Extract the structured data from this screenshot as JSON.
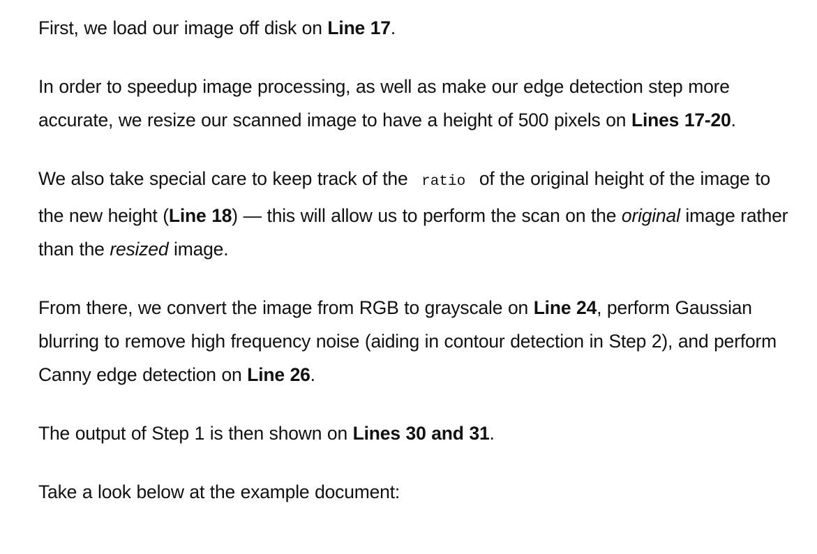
{
  "paragraphs": [
    {
      "segments": [
        {
          "text": "First, we load our image off disk on ",
          "style": "normal"
        },
        {
          "text": "Line 17",
          "style": "bold"
        },
        {
          "text": ".",
          "style": "normal"
        }
      ]
    },
    {
      "segments": [
        {
          "text": "In order to speedup image processing, as well as make our edge detection step more accurate, we resize our scanned image to have a height of 500 pixels on ",
          "style": "normal"
        },
        {
          "text": "Lines 17-20",
          "style": "bold"
        },
        {
          "text": ".",
          "style": "normal"
        }
      ]
    },
    {
      "segments": [
        {
          "text": "We also take special care to keep track of the ",
          "style": "normal"
        },
        {
          "text": "ratio",
          "style": "code"
        },
        {
          "text": " of the original height of the image to the new height (",
          "style": "normal"
        },
        {
          "text": "Line 18",
          "style": "bold"
        },
        {
          "text": ") — this will allow us to perform the scan on the ",
          "style": "normal"
        },
        {
          "text": "original",
          "style": "italic"
        },
        {
          "text": " image rather than the ",
          "style": "normal"
        },
        {
          "text": "resized",
          "style": "italic"
        },
        {
          "text": " image.",
          "style": "normal"
        }
      ]
    },
    {
      "segments": [
        {
          "text": "From there, we convert the image from RGB to grayscale on ",
          "style": "normal"
        },
        {
          "text": "Line 24",
          "style": "bold"
        },
        {
          "text": ", perform Gaussian blurring to remove high frequency noise (aiding in contour detection in Step 2), and perform Canny edge detection on ",
          "style": "normal"
        },
        {
          "text": "Line 26",
          "style": "bold"
        },
        {
          "text": ".",
          "style": "normal"
        }
      ]
    },
    {
      "segments": [
        {
          "text": "The output of Step 1 is then shown on ",
          "style": "normal"
        },
        {
          "text": "Lines 30 and 31",
          "style": "bold"
        },
        {
          "text": ".",
          "style": "normal"
        }
      ]
    },
    {
      "segments": [
        {
          "text": "Take a look below at the example document:",
          "style": "normal"
        }
      ]
    }
  ]
}
